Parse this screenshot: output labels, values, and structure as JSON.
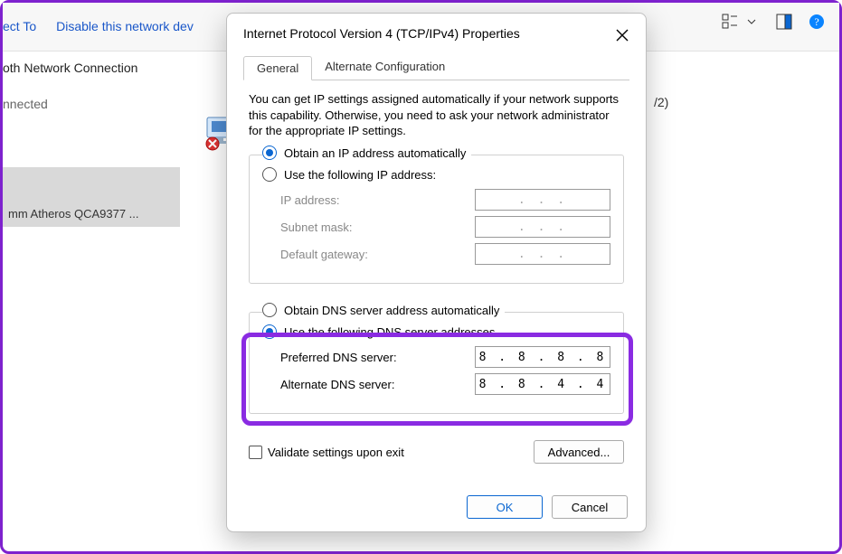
{
  "toolbar": {
    "connect_to": "ect To",
    "disable": "Disable this network dev",
    "icons": {
      "view": "view-options",
      "pane": "details-pane",
      "help": "help"
    }
  },
  "bg": {
    "conn_title": "oth Network Connection",
    "conn_status": "nnected",
    "adapter_truncated": "mm Atheros QCA9377 ...",
    "paren_fragment": "/2)"
  },
  "dialog": {
    "title": "Internet Protocol Version 4 (TCP/IPv4) Properties",
    "tabs": {
      "general": "General",
      "alt": "Alternate Configuration"
    },
    "intro": "You can get IP settings assigned automatically if your network supports this capability. Otherwise, you need to ask your network administrator for the appropriate IP settings.",
    "ip_auto": "Obtain an IP address automatically",
    "ip_manual": "Use the following IP address:",
    "ip_label": "IP address:",
    "subnet_label": "Subnet mask:",
    "gateway_label": "Default gateway:",
    "ip_placeholder": ".   .   .",
    "dns_auto": "Obtain DNS server address automatically",
    "dns_manual": "Use the following DNS server addresses",
    "pref_dns_label": "Preferred DNS server:",
    "alt_dns_label": "Alternate DNS server:",
    "pref_dns_value": "8 . 8 . 8 . 8",
    "alt_dns_value": "8 . 8 . 4 . 4",
    "validate": "Validate settings upon exit",
    "advanced": "Advanced...",
    "ok": "OK",
    "cancel": "Cancel"
  },
  "colors": {
    "accent": "#0a66d1",
    "highlight": "#8a2be2"
  }
}
